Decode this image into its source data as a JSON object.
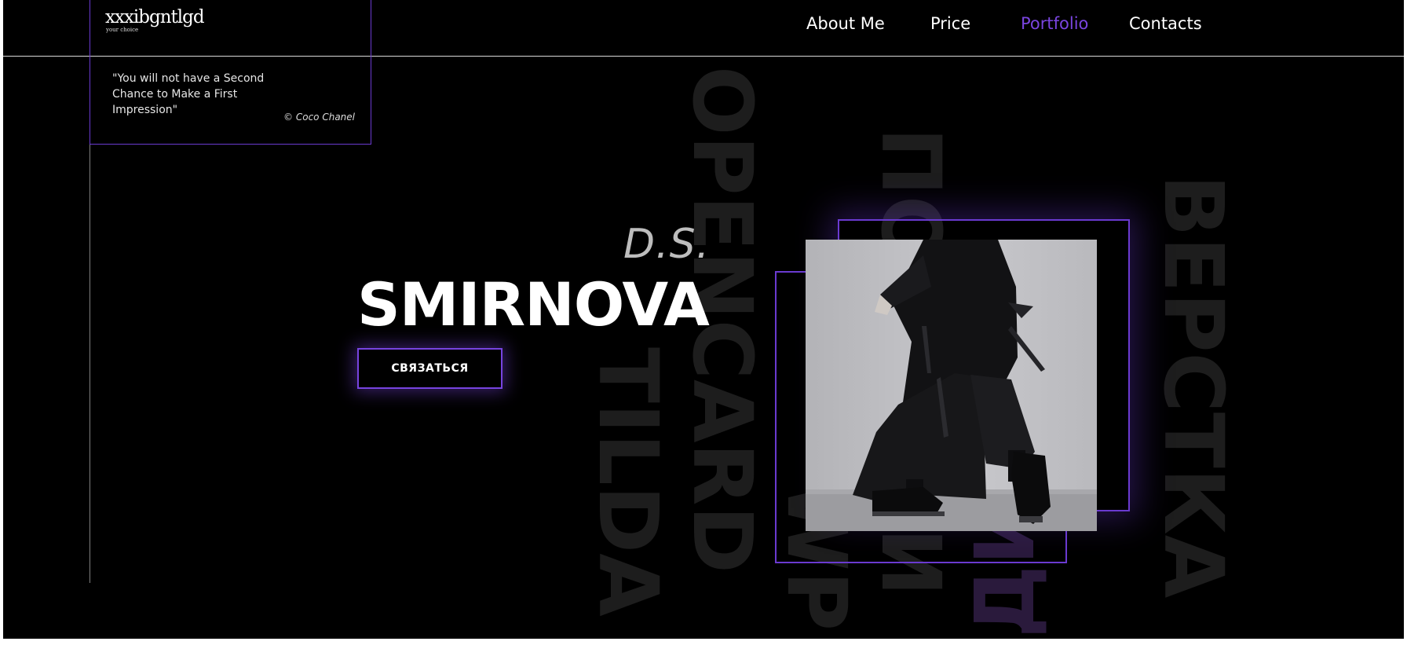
{
  "header": {
    "logo": {
      "name": "xxxibgntlgd",
      "tagline": "your choice"
    },
    "nav": [
      {
        "label": "About Me",
        "active": false
      },
      {
        "label": "Price",
        "active": false
      },
      {
        "label": "Portfolio",
        "active": true
      },
      {
        "label": "Contacts",
        "active": false
      }
    ]
  },
  "quote": {
    "text": "\"You will not have a Second Chance to Make a First Impression\"",
    "author": "© Coco Chanel"
  },
  "hero": {
    "initials": "D.S.",
    "surname": "SMIRNOVA",
    "cta_label": "СВЯЗАТЬСЯ"
  },
  "background_words": [
    "OPENCARD",
    "TILDA",
    "WP",
    "ПОСАДКИ",
    "ДИЗАЙН",
    "ВЕРСТКА"
  ],
  "photo": {
    "description_icon": "fashion-photo"
  },
  "colors": {
    "background": "#000000",
    "accent": "#7a45e0",
    "text": "#ffffff",
    "muted_word": "#1d1d1d"
  }
}
